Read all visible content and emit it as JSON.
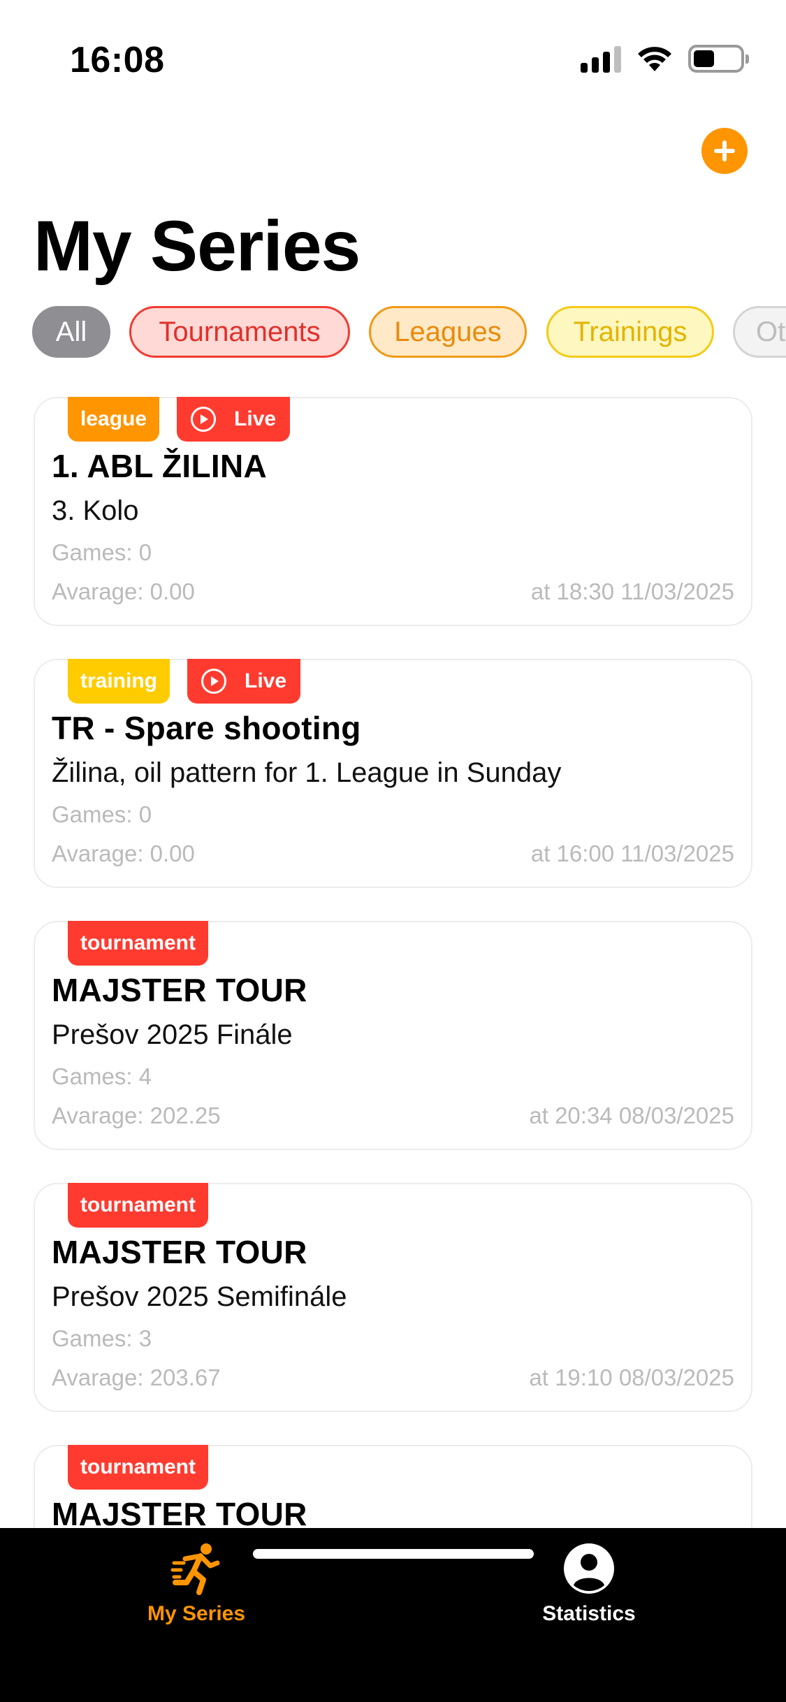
{
  "status_bar": {
    "time": "16:08",
    "signal_icon": "cellular-signal-icon",
    "wifi_icon": "wifi-icon",
    "battery_icon": "battery-icon",
    "battery_level": 0.45
  },
  "header": {
    "add_icon": "plus-icon",
    "title": "My Series"
  },
  "filters": [
    {
      "label": "All",
      "color": "#8E8E93"
    },
    {
      "label": "Tournaments",
      "color": "#FF3B30"
    },
    {
      "label": "Leagues",
      "color": "#FF9500"
    },
    {
      "label": "Trainings",
      "color": "#FFCC00"
    },
    {
      "label": "Ot",
      "color": "#D4D4D4"
    }
  ],
  "series": [
    {
      "type": "league",
      "live": "Live",
      "title": "1. ABL ŽILINA",
      "subtitle": "3. Kolo",
      "games": "Games: 0",
      "average": "Avarage: 0.00",
      "date": "at 18:30 11/03/2025"
    },
    {
      "type": "training",
      "live": "Live",
      "title": "TR - Spare shooting",
      "subtitle": "Žilina, oil pattern for 1. League in Sunday",
      "games": "Games: 0",
      "average": "Avarage: 0.00",
      "date": "at 16:00 11/03/2025"
    },
    {
      "type": "tournament",
      "title": "MAJSTER TOUR",
      "subtitle": "Prešov 2025 Finále",
      "games": "Games: 4",
      "average": "Avarage: 202.25",
      "date": "at 20:34 08/03/2025"
    },
    {
      "type": "tournament",
      "title": "MAJSTER TOUR",
      "subtitle": "Prešov 2025 Semifinále",
      "games": "Games: 3",
      "average": "Avarage: 203.67",
      "date": "at 19:10 08/03/2025"
    },
    {
      "type": "tournament",
      "title": "MAJSTER TOUR"
    }
  ],
  "tab_bar": {
    "tabs": [
      {
        "label": "My Series",
        "icon": "runner-icon",
        "active": true,
        "color": "#FF9500"
      },
      {
        "label": "Statistics",
        "icon": "person-circle-icon",
        "active": false,
        "color": "#FFFFFF"
      }
    ]
  }
}
